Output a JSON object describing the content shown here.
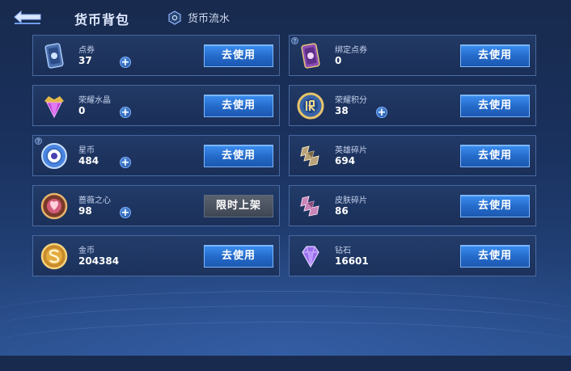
{
  "header": {
    "title": "货币背包",
    "flow_label": "货币流水"
  },
  "currencies": [
    {
      "name": "点券",
      "amount": "37",
      "action": "去使用"
    },
    {
      "name": "绑定点券",
      "amount": "0",
      "action": "去使用"
    },
    {
      "name": "荣耀水晶",
      "amount": "0",
      "action": "去使用"
    },
    {
      "name": "荣耀积分",
      "amount": "38",
      "action": "去使用"
    },
    {
      "name": "星币",
      "amount": "484",
      "action": "去使用"
    },
    {
      "name": "英雄碎片",
      "amount": "694",
      "action": "去使用"
    },
    {
      "name": "蔷薇之心",
      "amount": "98",
      "action": "限时上架"
    },
    {
      "name": "皮肤碎片",
      "amount": "86",
      "action": "去使用"
    },
    {
      "name": "金币",
      "amount": "204384",
      "action": "去使用"
    },
    {
      "name": "钻石",
      "amount": "16601",
      "action": "去使用"
    }
  ],
  "colors": {
    "accent": "#2f7fe6",
    "card_border": "#6e96d7",
    "background": "#1a3260"
  }
}
